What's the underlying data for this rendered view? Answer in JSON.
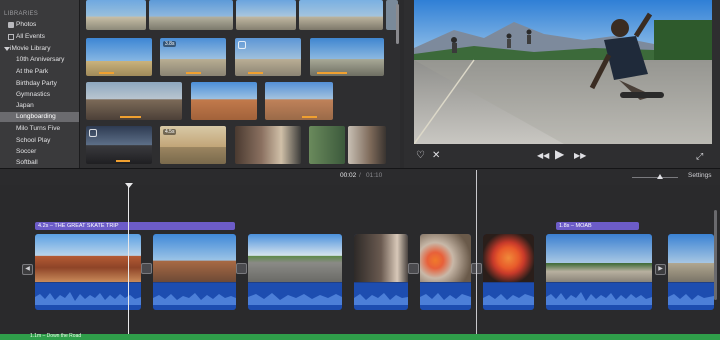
{
  "sidebar": {
    "libraries_heading": "LIBRARIES",
    "photos": "Photos",
    "all_events": "All Events",
    "library_name": "iMovie Library",
    "events": [
      "10th Anniversary",
      "At the Park",
      "Birthday Party",
      "Gymnastics",
      "Japan",
      "Longboarding",
      "Milo Turns Five",
      "School Play",
      "Soccer",
      "Softball"
    ],
    "selected_event": "Longboarding"
  },
  "browser": {
    "badges": [
      "3.8s",
      "4.5s"
    ]
  },
  "timeline": {
    "current_time": "00:02",
    "separator": "/",
    "total_time": "01:10",
    "settings_label": "Settings",
    "title_clip_1": "4.2s – THE GREAT SKATE TRIP",
    "title_clip_2": "1.8s – MOAB",
    "music_track": "1.1m – Down the Road"
  },
  "icons": {
    "favorite": "heart-icon",
    "reject": "x-icon",
    "prev": "skip-back-icon",
    "play": "play-icon",
    "next": "skip-forward-icon",
    "fullscreen": "expand-icon"
  },
  "colors": {
    "title_bar": "#6c5cc8",
    "audio": "#1d4db0",
    "music": "#2f9e4a",
    "selection": "#6b6b6f",
    "progress": "#f0a030"
  }
}
